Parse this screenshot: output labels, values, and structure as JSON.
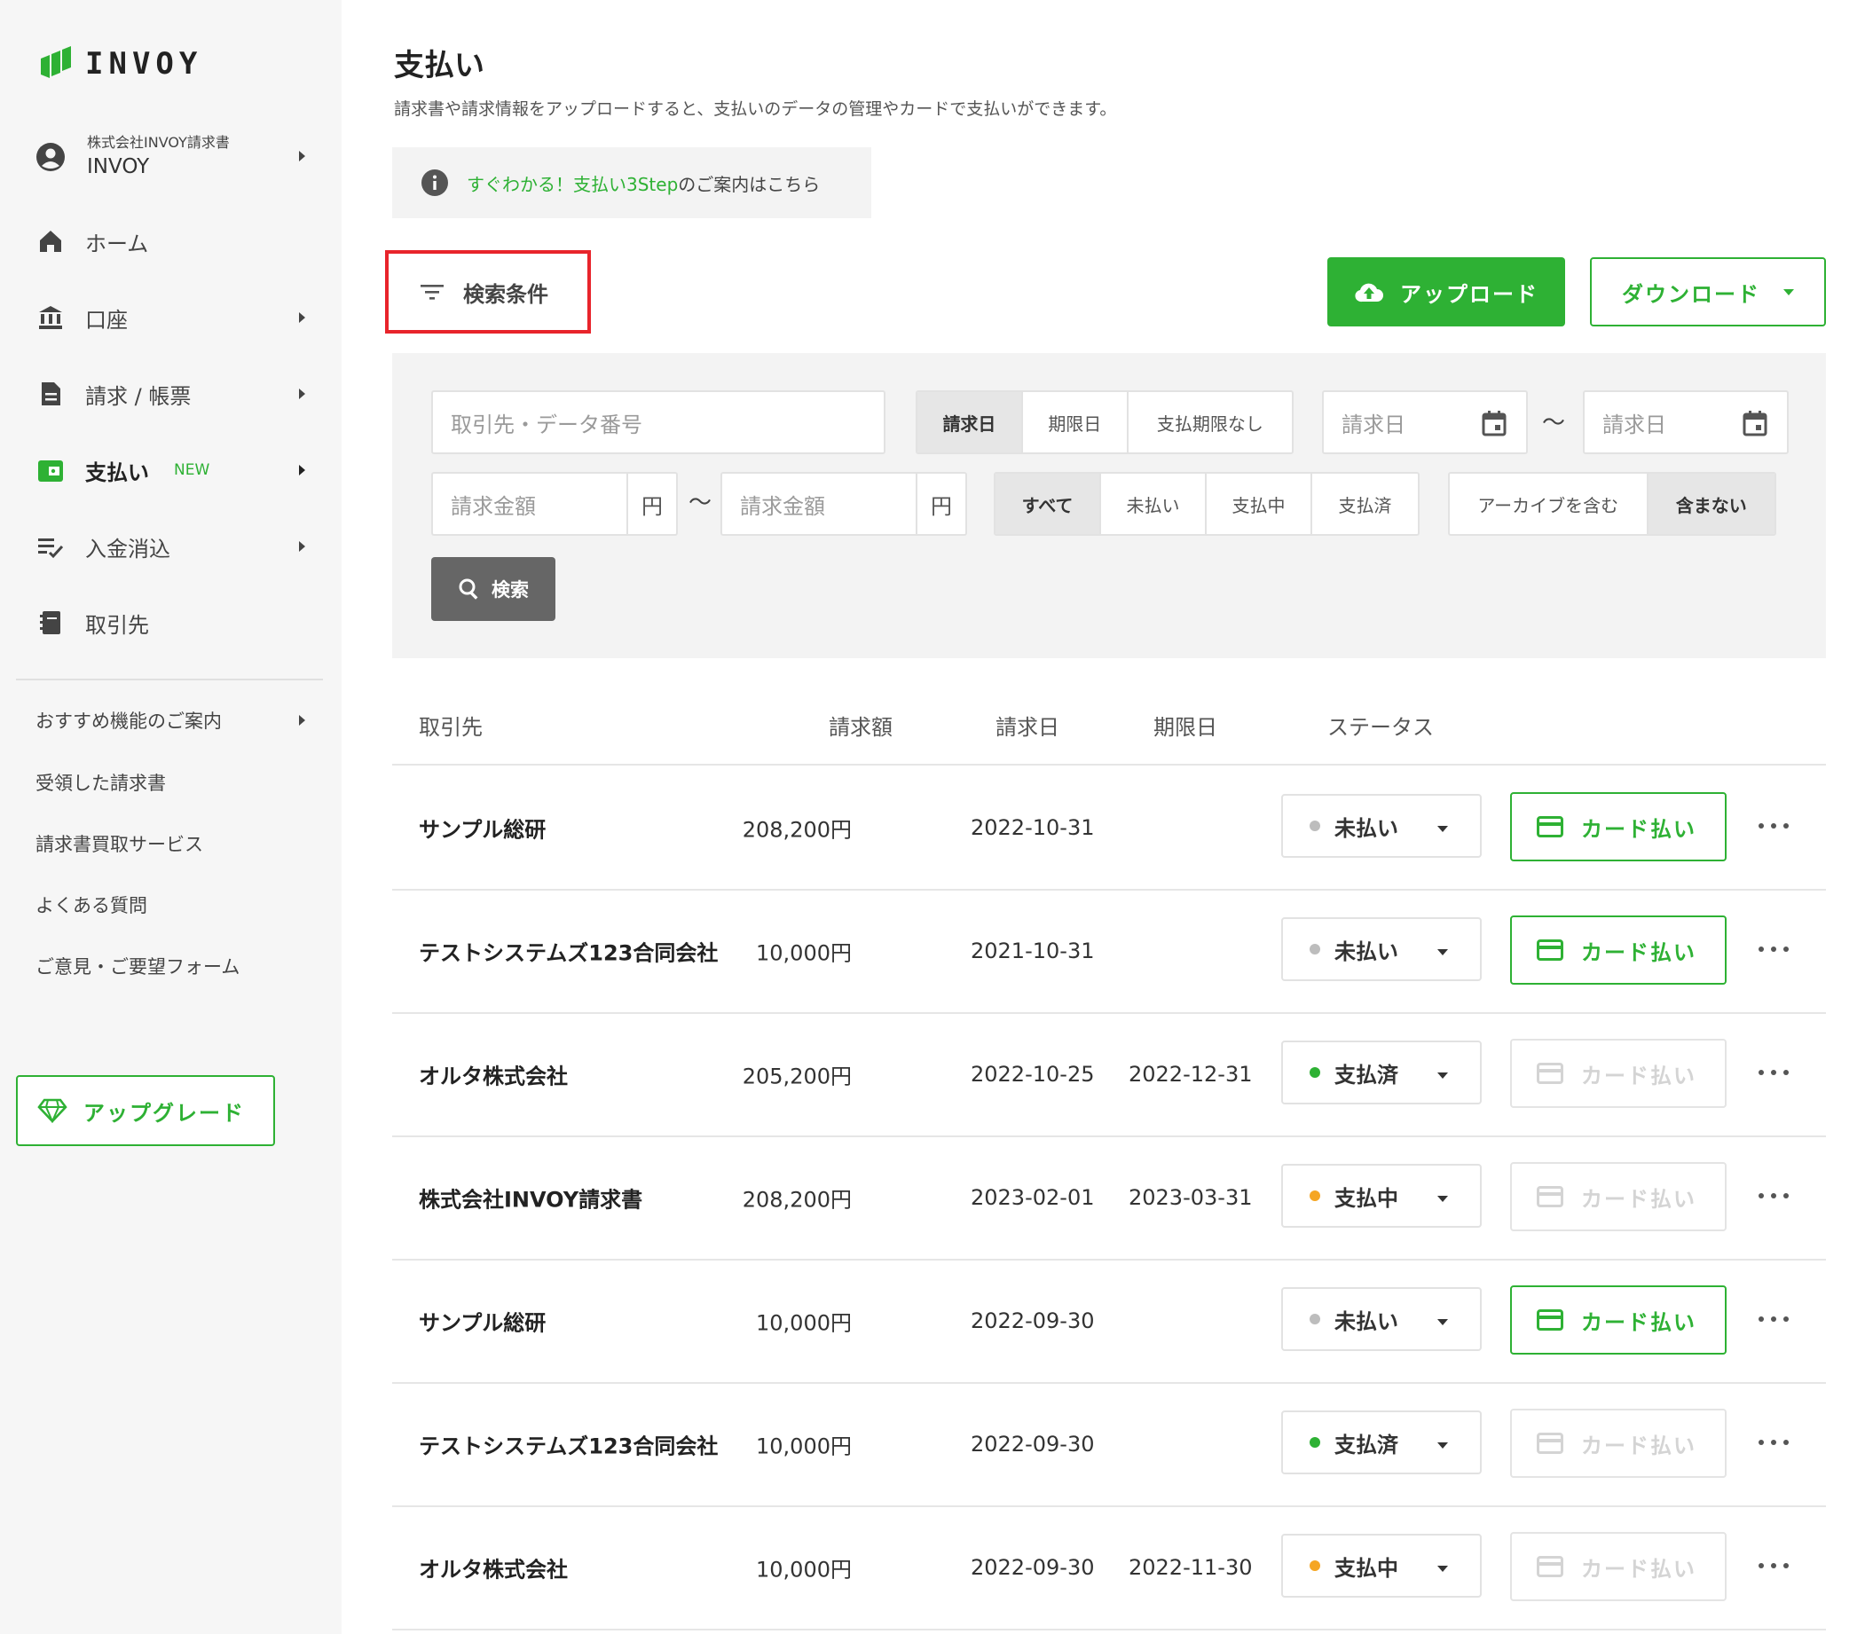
{
  "brand": {
    "name": "INVOY",
    "accent": "#2eb134"
  },
  "sidebar": {
    "company": {
      "org": "株式会社INVOY請求書",
      "user": "INVOY"
    },
    "items": [
      {
        "label": "ホーム",
        "icon": "home-icon"
      },
      {
        "label": "口座",
        "icon": "bank-icon"
      },
      {
        "label": "請求 / 帳票",
        "icon": "document-icon"
      },
      {
        "label": "支払い",
        "icon": "wallet-icon",
        "badge": "NEW"
      },
      {
        "label": "入金消込",
        "icon": "checklist-icon"
      },
      {
        "label": "取引先",
        "icon": "contacts-book-icon"
      }
    ],
    "sub_items": [
      {
        "label": "おすすめ機能のご案内"
      },
      {
        "label": "受領した請求書"
      },
      {
        "label": "請求書買取サービス"
      },
      {
        "label": "よくある質問"
      },
      {
        "label": "ご意見・ご要望フォーム"
      }
    ],
    "upgrade_label": "アップグレード"
  },
  "page": {
    "title": "支払い",
    "description": "請求書や請求情報をアップロードすると、支払いのデータの管理やカードで支払いができます。",
    "info": {
      "link": "すぐわかる！支払い3Step",
      "rest": "のご案内はこちら"
    }
  },
  "toolbar": {
    "filter_label": "検索条件",
    "upload_label": "アップロード",
    "download_label": "ダウンロード"
  },
  "search": {
    "keyword_placeholder": "取引先・データ番号",
    "date_type_options": [
      "請求日",
      "期限日",
      "支払期限なし"
    ],
    "date_type_selected": "請求日",
    "date_from_placeholder": "請求日",
    "date_to_placeholder": "請求日",
    "tilde": "〜",
    "amount_from_placeholder": "請求金額",
    "amount_to_placeholder": "請求金額",
    "currency_unit": "円",
    "status_options": [
      "すべて",
      "未払い",
      "支払中",
      "支払済"
    ],
    "status_selected": "すべて",
    "archive_options": [
      "アーカイブを含む",
      "含まない"
    ],
    "archive_selected": "含まない",
    "search_button": "検索"
  },
  "table": {
    "headers": {
      "partner": "取引先",
      "amount": "請求額",
      "invoice_date": "請求日",
      "due_date": "期限日",
      "status": "ステータス"
    },
    "card_pay_label": "カード払い",
    "status_colors": {
      "未払い": "#bdbdbd",
      "支払済": "#2eb134",
      "支払中": "#f5a623"
    },
    "rows": [
      {
        "partner": "サンプル総研",
        "amount": "208,200円",
        "invoice_date": "2022-10-31",
        "due_date": "",
        "status": "未払い",
        "card_enabled": true
      },
      {
        "partner": "テストシステムズ123合同会社",
        "amount": "10,000円",
        "invoice_date": "2021-10-31",
        "due_date": "",
        "status": "未払い",
        "card_enabled": true
      },
      {
        "partner": "オルタ株式会社",
        "amount": "205,200円",
        "invoice_date": "2022-10-25",
        "due_date": "2022-12-31",
        "status": "支払済",
        "card_enabled": false
      },
      {
        "partner": "株式会社INVOY請求書",
        "amount": "208,200円",
        "invoice_date": "2023-02-01",
        "due_date": "2023-03-31",
        "status": "支払中",
        "card_enabled": false
      },
      {
        "partner": "サンプル総研",
        "amount": "10,000円",
        "invoice_date": "2022-09-30",
        "due_date": "",
        "status": "未払い",
        "card_enabled": true
      },
      {
        "partner": "テストシステムズ123合同会社",
        "amount": "10,000円",
        "invoice_date": "2022-09-30",
        "due_date": "",
        "status": "支払済",
        "card_enabled": false
      },
      {
        "partner": "オルタ株式会社",
        "amount": "10,000円",
        "invoice_date": "2022-09-30",
        "due_date": "2022-11-30",
        "status": "支払中",
        "card_enabled": false
      }
    ]
  }
}
